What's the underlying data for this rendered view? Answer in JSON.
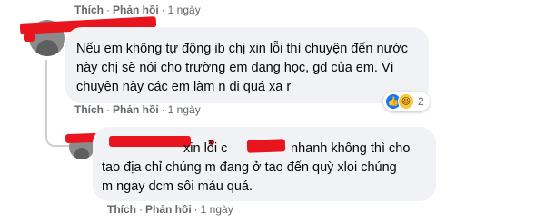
{
  "comment_top": {
    "like": "Thích",
    "reply": "Phản hồi",
    "time": "1 ngày"
  },
  "comment1": {
    "text_lines": [
      "Nếu em không tự động ib chị xin lỗi thì chuyện đến nước",
      "này chị sẽ nói cho trường em đang học, gđ của em. Vì",
      "chuyện này các em làm n đi quá xa r"
    ],
    "reaction_count": "2",
    "reaction_icons": [
      "like-icon",
      "haha-icon"
    ],
    "actions": {
      "like": "Thích",
      "reply": "Phản hồi",
      "time": "1 ngày"
    }
  },
  "reply1": {
    "line1_part1": "xin lỗi c",
    "line1_part2": "nhanh không thì cho",
    "text_lines": [
      "tao địa chỉ chúng m đang ở tao đến quỳ xloi chúng",
      "m ngay dcm sôi máu quá."
    ],
    "actions": {
      "like": "Thích",
      "reply": "Phản hồi",
      "time": "1 ngày"
    }
  },
  "colors": {
    "redaction": "#e8141e",
    "bubble": "#f0f2f5",
    "meta": "#65676b",
    "like": "#1877f2"
  }
}
